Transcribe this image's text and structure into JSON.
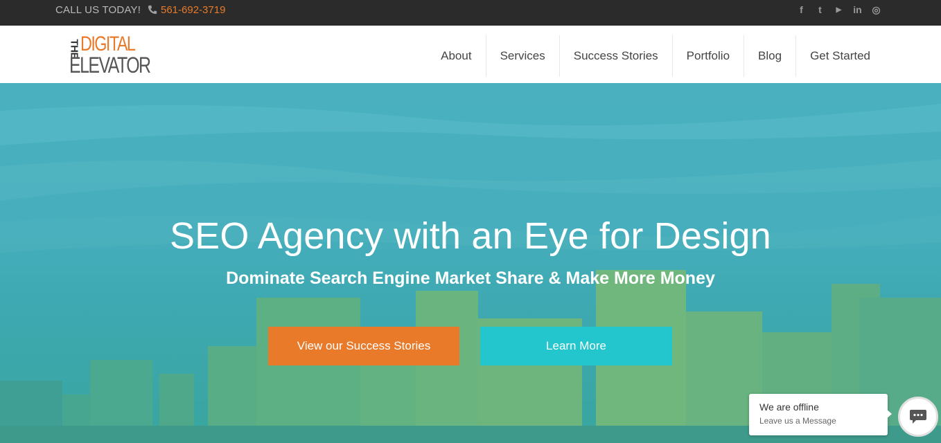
{
  "topbar": {
    "call_label": "CALL US TODAY!",
    "phone": "561-692-3719",
    "social_icons": [
      "facebook-icon",
      "twitter-icon",
      "youtube-icon",
      "linkedin-icon",
      "instagram-icon"
    ],
    "social_glyphs": [
      "f",
      "t",
      "▶",
      "in",
      "◎"
    ]
  },
  "logo": {
    "the": "THE",
    "digital": "DIGITAL",
    "elevator": "ELEVATOR"
  },
  "nav": {
    "items": [
      "About",
      "Services",
      "Success Stories",
      "Portfolio",
      "Blog",
      "Get Started"
    ]
  },
  "hero": {
    "title": "SEO Agency with an Eye for Design",
    "subtitle": "Dominate Search Engine Market Share & Make More Money",
    "primary_button": "View our Success Stories",
    "secondary_button": "Learn More"
  },
  "chat": {
    "status": "We are offline",
    "prompt": "Leave us a Message"
  },
  "colors": {
    "accent_orange": "#e87a29",
    "accent_teal": "#22c6cc",
    "topbar_bg": "#2b2b2b"
  }
}
